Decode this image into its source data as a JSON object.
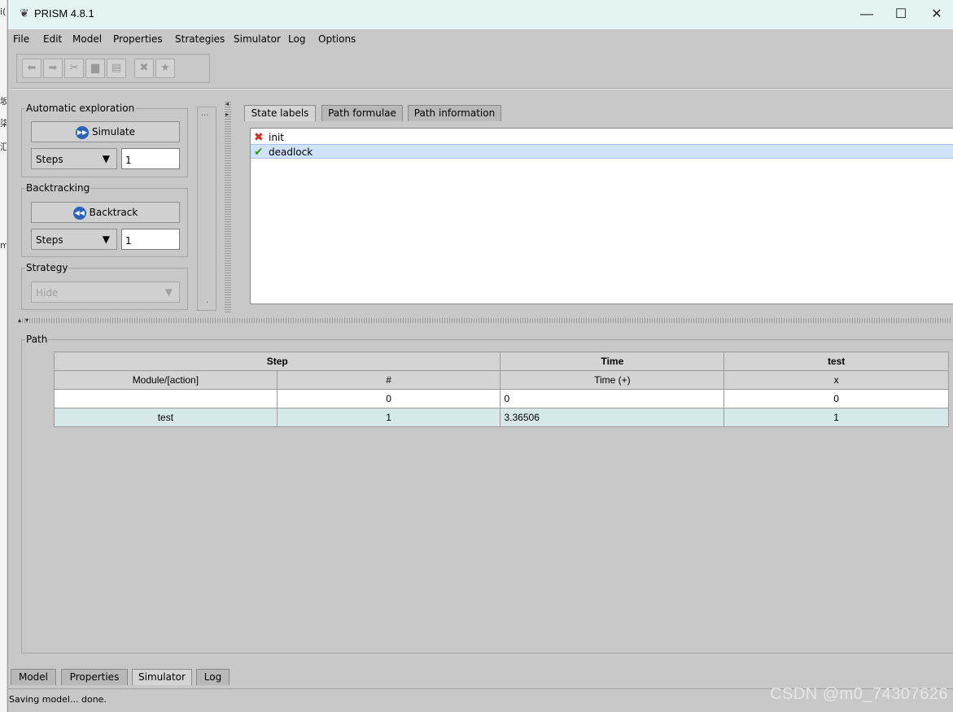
{
  "left_strip_chars": [
    "i(",
    "坂",
    "柒",
    "汇",
    "m"
  ],
  "window": {
    "title": "PRISM 4.8.1",
    "controls": {
      "minimize": "—",
      "maximize": "☐",
      "close": "✕"
    }
  },
  "menu": [
    "File",
    "Edit",
    "Model",
    "Properties",
    "Strategies",
    "Simulator",
    "Log",
    "Options"
  ],
  "toolbar_icons": [
    "undo-icon",
    "redo-icon",
    "cut-icon",
    "copy-icon",
    "paste-icon",
    "delete-icon",
    "select-all-icon"
  ],
  "automatic_exploration": {
    "title": "Automatic exploration",
    "button": "Simulate",
    "mode": "Steps",
    "value": "1"
  },
  "backtracking": {
    "title": "Backtracking",
    "button": "Backtrack",
    "mode": "Steps",
    "value": "1"
  },
  "strategy": {
    "title": "Strategy",
    "selected": "Hide"
  },
  "collapsed_pane": {
    "top_label": "...",
    "bottom_label": "."
  },
  "tabs": [
    "State labels",
    "Path formulae",
    "Path information"
  ],
  "state_labels": [
    {
      "name": "init",
      "status": "false",
      "icon": "red-x-icon",
      "color": "#d52b1e"
    },
    {
      "name": "deadlock",
      "status": "true",
      "icon": "green-check-icon",
      "color": "#2f9d27"
    }
  ],
  "path": {
    "title": "Path",
    "group_headers": [
      "Step",
      "Time",
      "test"
    ],
    "columns": [
      "Module/[action]",
      "#",
      "Time (+)",
      "x"
    ],
    "rows": [
      [
        "",
        "0",
        "0",
        "0"
      ],
      [
        "test",
        "1",
        "3.36506",
        "1"
      ]
    ]
  },
  "bottom_tabs": [
    "Model",
    "Properties",
    "Simulator",
    "Log"
  ],
  "active_bottom_tab": "Simulator",
  "status": "Saving model... done.",
  "watermark": "CSDN @m0_74307626"
}
